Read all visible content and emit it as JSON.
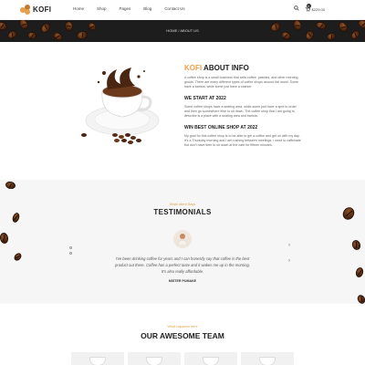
{
  "header": {
    "logo": "KOFI",
    "nav": [
      "Home",
      "Shop",
      "Pages",
      "Blog",
      "Contact Us"
    ],
    "cart_count": "0",
    "cart_total": "$229.00"
  },
  "banner": {
    "breadcrumb": "HOME / ABOUT US"
  },
  "about": {
    "title_accent": "KOFI",
    "title_rest": "ABOUT INFO",
    "intro": "A coffee shop is a small business that sells coffee, pastries, and other morning goods. There are many different types of coffee shops around the world. Some have a barista, while some just have a cashier.",
    "h_start": "WE START AT 2022",
    "p_start": "Some coffee shops have a seating area, while some just have a spot to order and then go somewhere else to sit down. The coffee shop that I am going to describe is a place with a seating area and barista.",
    "h_win": "WIN BEST ONLINE SHOP AT 2022",
    "p_win": "My goal for this coffee shop is to be able to get a coffee and get on with my day. It's a Thursday morning and I am rushing between meetings. I need to caffeinate but don't have time to sit down at the cafe for fifteen minutes."
  },
  "testimonials": {
    "subtitle": "What client Says",
    "title": "TESTIMONIALS",
    "quote": "I've been drinking coffee for years and I can honestly say that coffee is the best product out there. Coffee has a perfect taste and it wakes me up in the morning. It's also really affordable.",
    "author": "MISTER PUMAKE",
    "prev_icon": "chevron-up-icon",
    "next_icon": "chevron-down-icon"
  },
  "team": {
    "subtitle": "What happens here",
    "title": "OUR AWESOME TEAM"
  },
  "colors": {
    "accent": "#e4a14a",
    "banner_bg": "#1d1d1d",
    "testimonial_bg": "#f6f6f6"
  }
}
